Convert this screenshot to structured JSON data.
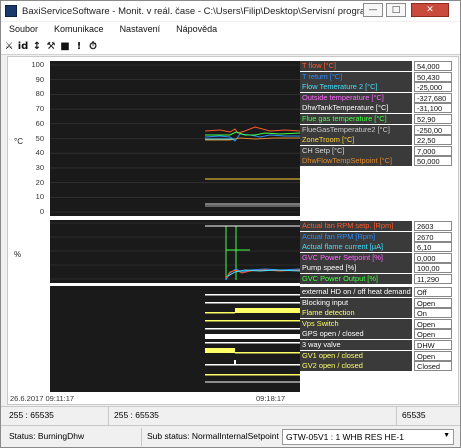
{
  "window": {
    "title": "BaxiServiceSoftware - Monit. v reál. čase - C:\\Users\\Filip\\Desktop\\Servisní programy\\prime ulo...",
    "controls": [
      "—",
      "□",
      "✕"
    ]
  },
  "menu": [
    "Soubor",
    "Komunikace",
    "Nastavení",
    "Nápověda"
  ],
  "toolbar_icons": [
    "wrench-question-icon",
    "id-icon",
    "thermometer-icon",
    "wrench-icon",
    "lock-icon",
    "exclamation-icon",
    "timer-icon"
  ],
  "toolbar_glyphs": [
    "⚔",
    "id",
    "↕",
    "⚒",
    "■",
    "!",
    "⏱"
  ],
  "temp_chart": {
    "y_axis_label": "°C",
    "ticks": [
      "100",
      "90",
      "80",
      "70",
      "60",
      "50",
      "40",
      "30",
      "20",
      "10",
      "0"
    ],
    "series": [
      {
        "label": "T flow [°C]",
        "value": "54,000",
        "color": "#ff5a2a"
      },
      {
        "label": "T return [°C]",
        "value": "50,430",
        "color": "#2a8cff"
      },
      {
        "label": "Flow Temerature 2 [°C]",
        "value": "-25,000",
        "color": "#40e0ff"
      },
      {
        "label": "Outside temperature [°C]",
        "value": "-327,680",
        "color": "#ff66ff"
      },
      {
        "label": "DhwTankTemperature [°C]",
        "value": "-31,100",
        "color": "#ffffff"
      },
      {
        "label": "Flue gas temperature [°C]",
        "value": "52,90",
        "color": "#40ff40"
      },
      {
        "label": "FlueGasTemperature2 [°C]",
        "value": "-250,00",
        "color": "#c8c8c8"
      },
      {
        "label": "ZoneTroom [°C]",
        "value": "22,50",
        "color": "#ffd23a"
      },
      {
        "label": "CH Setp [°C]",
        "value": "7,000",
        "color": "#d8d8d8"
      },
      {
        "label": "DhwFlowTempSetpoint [°C]",
        "value": "50,000",
        "color": "#e08a2a"
      }
    ]
  },
  "pct_chart": {
    "y_axis_label": "%",
    "series": [
      {
        "label": "Actual fan RPM setp. [Rpm]",
        "value": "2603",
        "color": "#ff5a2a"
      },
      {
        "label": "Actual fan RPM [Rpm]",
        "value": "2670",
        "color": "#2a8cff"
      },
      {
        "label": "Actual flame current [µA]",
        "value": "6,10",
        "color": "#40e0ff"
      },
      {
        "label": "GVC  Power Setpoint [%]",
        "value": "0,000",
        "color": "#ff66ff"
      },
      {
        "label": "Pump speed [%]",
        "value": "100,00",
        "color": "#ffffff"
      },
      {
        "label": "GVC  Power Output [%]",
        "value": "11,290",
        "color": "#40ff40"
      }
    ]
  },
  "switches": [
    {
      "label": "external HD on / off heat demand",
      "value": "Off",
      "color": "#ffffff"
    },
    {
      "label": "Blocking input",
      "value": "Open",
      "color": "#ffffff"
    },
    {
      "label": "Flame detection",
      "value": "On",
      "color": "#ffff66"
    },
    {
      "label": "Vps Switch",
      "value": "Open",
      "color": "#ffff66"
    },
    {
      "label": "GPS open / closed",
      "value": "Open",
      "color": "#ffffff"
    },
    {
      "label": "3 way valve",
      "value": "DHW",
      "color": "#ffffff"
    },
    {
      "label": "GV1 open / closed",
      "value": "Open",
      "color": "#ffff66"
    },
    {
      "label": "GV2 open / closed",
      "value": "Closed",
      "color": "#ffff66"
    }
  ],
  "time": {
    "start": "26.6.2017 09:11:17",
    "end": "09:18:17"
  },
  "status_row1": {
    "cell1": "255  :  65535",
    "cell2": "255  :  65535",
    "cell3": "65535"
  },
  "status_row2": {
    "status": "Status: BurningDhw",
    "sub_status": "Sub status: NormalInternalSetpoint",
    "device": "GTW-05V1 :  1 WHB RES HE-1"
  }
}
